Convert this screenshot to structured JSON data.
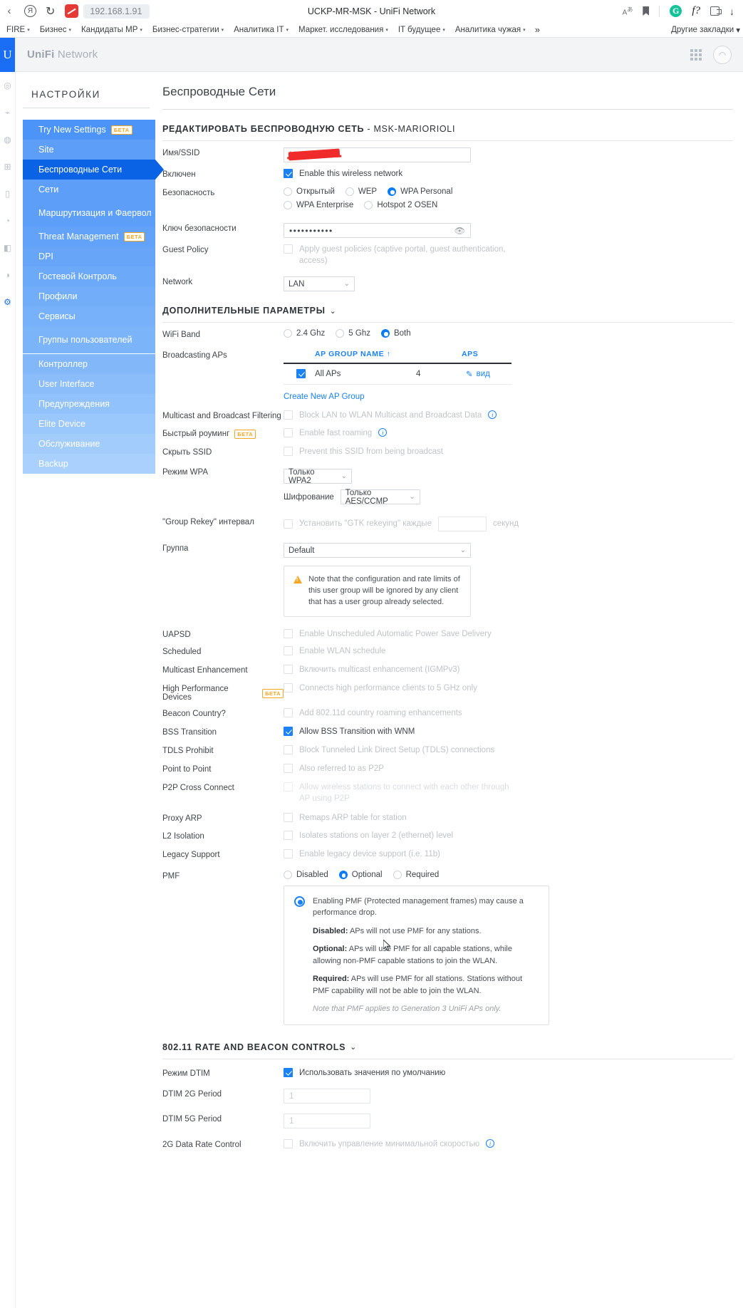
{
  "browser": {
    "url": "192.168.1.91",
    "tab_title": "UCKP-MR-MSK - UniFi Network",
    "back_label": "‹",
    "reload_label": "↻",
    "yandex_label": "Я",
    "translate_label": "A",
    "translate_sup": "あ",
    "grammarly_label": "G",
    "f_label": "f?",
    "download_label": "↓",
    "bookmarks": [
      {
        "label": "FIRE"
      },
      {
        "label": "Бизнес"
      },
      {
        "label": "Кандидаты МР"
      },
      {
        "label": "Бизнес-стратегии"
      },
      {
        "label": "Аналитика IT"
      },
      {
        "label": "Маркет. исследования"
      },
      {
        "label": "IT будущее"
      },
      {
        "label": "Аналитика чужая"
      }
    ],
    "bookmarks_overflow": "»",
    "other_bookmarks": "Другие закладки",
    "caret": "▾"
  },
  "app": {
    "brand_bold": "UniFi",
    "brand_rest": " Network",
    "logo_letter": "U"
  },
  "sidebar": {
    "title": "НАСТРОЙКИ",
    "items": [
      {
        "label": "Try New Settings",
        "badge": "БЕТА"
      },
      {
        "label": "Site"
      },
      {
        "label": "Беспроводные Сети",
        "active": true
      },
      {
        "label": "Сети"
      },
      {
        "label": "Маршрутизация и Фаервол",
        "tall": true
      },
      {
        "label": "Threat Management",
        "badge": "БЕТА"
      },
      {
        "label": "DPI"
      },
      {
        "label": "Гостевой Контроль"
      },
      {
        "label": "Профили"
      },
      {
        "label": "Сервисы"
      },
      {
        "label": "Группы пользователей",
        "tall": true
      },
      {
        "label": "Контроллер",
        "sep": true
      },
      {
        "label": "User Interface"
      },
      {
        "label": "Предупреждения"
      },
      {
        "label": "Elite Device"
      },
      {
        "label": "Обслуживание"
      },
      {
        "label": "Backup"
      }
    ]
  },
  "main": {
    "page_title": "Беспроводные Сети",
    "edit_header_bold": "РЕДАКТИРОВАТЬ БЕСПРОВОДНУЮ СЕТЬ",
    "edit_header_rest": " - MSK-MARIORIOLI",
    "ssid": {
      "label": "Имя/SSID",
      "value": "MSK-Mar…"
    },
    "enabled": {
      "label": "Включен",
      "checkbox_label": "Enable this wireless network",
      "checked": true
    },
    "security": {
      "label": "Безопасность",
      "options": [
        "Открытый",
        "WEP",
        "WPA Personal",
        "WPA Enterprise",
        "Hotspot 2 OSEN"
      ],
      "selected": "WPA Personal"
    },
    "security_key": {
      "label": "Ключ безопасности",
      "value": "•••••••••••",
      "eye_icon": "👁"
    },
    "guest_policy": {
      "label": "Guest Policy",
      "checkbox_label": "Apply guest policies (captive portal, guest authentication, access)",
      "checked": false
    },
    "network": {
      "label": "Network",
      "value": "LAN"
    },
    "advanced_header": "ДОПОЛНИТЕЛЬНЫЕ ПАРАМЕТРЫ",
    "chevron": "⌄",
    "wifi_band": {
      "label": "WiFi Band",
      "options": [
        "2.4 Ghz",
        "5 Ghz",
        "Both"
      ],
      "selected": "Both"
    },
    "broadcasting_aps": {
      "label": "Broadcasting APs",
      "columns": [
        "AP GROUP NAME",
        "APS"
      ],
      "sort_arrow": "↑",
      "rows": [
        {
          "checked": true,
          "name": "All APs",
          "aps": "4",
          "action": "вид",
          "action_icon": "✎"
        }
      ],
      "create_link": "Create New AP Group"
    },
    "multicast_filtering": {
      "label": "Multicast and Broadcast Filtering",
      "checkbox_label": "Block LAN to WLAN Multicast and Broadcast Data",
      "checked": false,
      "info": "i"
    },
    "fast_roaming": {
      "label": "Быстрый роуминг",
      "badge": "БЕТА",
      "checkbox_label": "Enable fast roaming",
      "checked": false,
      "info": "i"
    },
    "hide_ssid": {
      "label": "Скрыть SSID",
      "checkbox_label": "Prevent this SSID from being broadcast",
      "checked": false
    },
    "wpa_mode": {
      "label": "Режим WPA",
      "value": "Только WPA2",
      "enc_label": "Шифрование",
      "enc_value": "Только AES/CCMP"
    },
    "group_rekey": {
      "label": "\"Group Rekey\" интервал",
      "checkbox_label": "Установить \"GTK rekeying\" каждые",
      "checked": false,
      "unit": "секунд"
    },
    "group": {
      "label": "Группа",
      "value": "Default",
      "note": "Note that the configuration and rate limits of this user group will be ignored by any client that has a user group already selected."
    },
    "uapsd": {
      "label": "UAPSD",
      "checkbox_label": "Enable Unscheduled Automatic Power Save Delivery",
      "checked": false
    },
    "scheduled": {
      "label": "Scheduled",
      "checkbox_label": "Enable WLAN schedule",
      "checked": false
    },
    "multicast_enh": {
      "label": "Multicast Enhancement",
      "checkbox_label": "Включить multicast enhancement (IGMPv3)",
      "checked": false
    },
    "high_perf": {
      "label": "High Performance Devices",
      "badge": "БЕТА",
      "checkbox_label": "Connects high performance clients to 5 GHz only",
      "checked": false
    },
    "beacon_country": {
      "label": "Beacon Country?",
      "checkbox_label": "Add 802.11d country roaming enhancements",
      "checked": false
    },
    "bss_transition": {
      "label": "BSS Transition",
      "checkbox_label": "Allow BSS Transition with WNM",
      "checked": true
    },
    "tdls": {
      "label": "TDLS Prohibit",
      "checkbox_label": "Block Tunneled Link Direct Setup (TDLS) connections",
      "checked": false
    },
    "p2p": {
      "label": "Point to Point",
      "checkbox_label": "Also referred to as P2P",
      "checked": false
    },
    "p2p_cross": {
      "label": "P2P Cross Connect",
      "checkbox_label": "Allow wireless stations to connect with each other through AP using P2P",
      "checked": false
    },
    "proxy_arp": {
      "label": "Proxy ARP",
      "checkbox_label": "Remaps ARP table for station",
      "checked": false
    },
    "l2_isolation": {
      "label": "L2 Isolation",
      "checkbox_label": "Isolates stations on layer 2 (ethernet) level",
      "checked": false
    },
    "legacy": {
      "label": "Legacy Support",
      "checkbox_label": "Enable legacy device support (i.e. 11b)",
      "checked": false
    },
    "pmf": {
      "label": "PMF",
      "options": [
        "Disabled",
        "Optional",
        "Required"
      ],
      "selected": "Optional",
      "info_intro": "Enabling PMF (Protected management frames) may cause a performance drop.",
      "disabled_b": "Disabled:",
      "disabled_t": " APs will not use PMF for any stations.",
      "optional_b": "Optional:",
      "optional_t": " APs will use PMF for all capable stations, while allowing non-PMF capable stations to join the WLAN.",
      "required_b": "Required:",
      "required_t": " APs will use PMF for all stations. Stations without PMF capability will not be able to join the WLAN.",
      "note": "Note that PMF applies to Generation 3 UniFi APs only."
    },
    "rate_header": "802.11 RATE AND BEACON CONTROLS",
    "dtim_mode": {
      "label": "Режим DTIM",
      "checkbox_label": "Использовать значения по умолчанию",
      "checked": true
    },
    "dtim_2g": {
      "label": "DTIM 2G Period",
      "value": "1"
    },
    "dtim_5g": {
      "label": "DTIM 5G Period",
      "value": "1"
    },
    "rate_2g": {
      "label": "2G Data Rate Control",
      "checkbox_label": "Включить управление минимальной скоростью",
      "checked": false,
      "info": "i"
    }
  }
}
